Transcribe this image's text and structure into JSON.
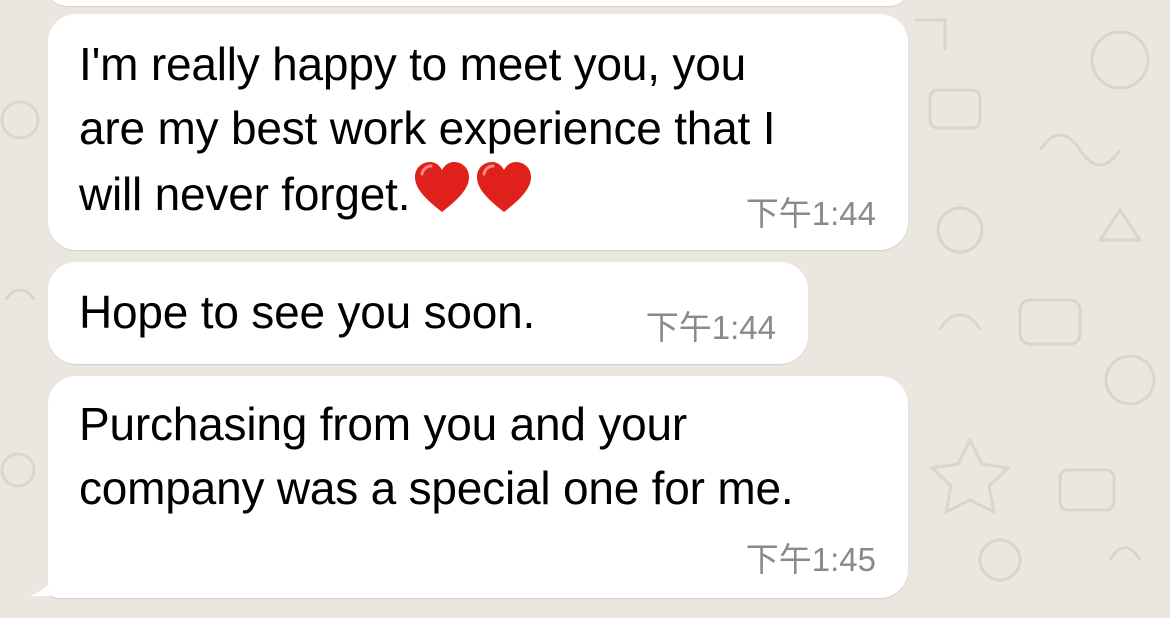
{
  "colors": {
    "wallpaper": "#ebe6df",
    "bubble": "#ffffff",
    "timestamp": "#8a8a8a",
    "heart": "#e0201b"
  },
  "messages": [
    {
      "text_lines": [
        "I'm really happy to meet you, you",
        "are my best work experience that I",
        "will never forget."
      ],
      "emoji": [
        "red-heart-icon",
        "red-heart-icon"
      ],
      "time": "下午1:44"
    },
    {
      "text": "Hope to see you soon.",
      "time": "下午1:44"
    },
    {
      "text_lines": [
        "Purchasing from you and your",
        "company was a special one for me."
      ],
      "time": "下午1:45"
    }
  ]
}
